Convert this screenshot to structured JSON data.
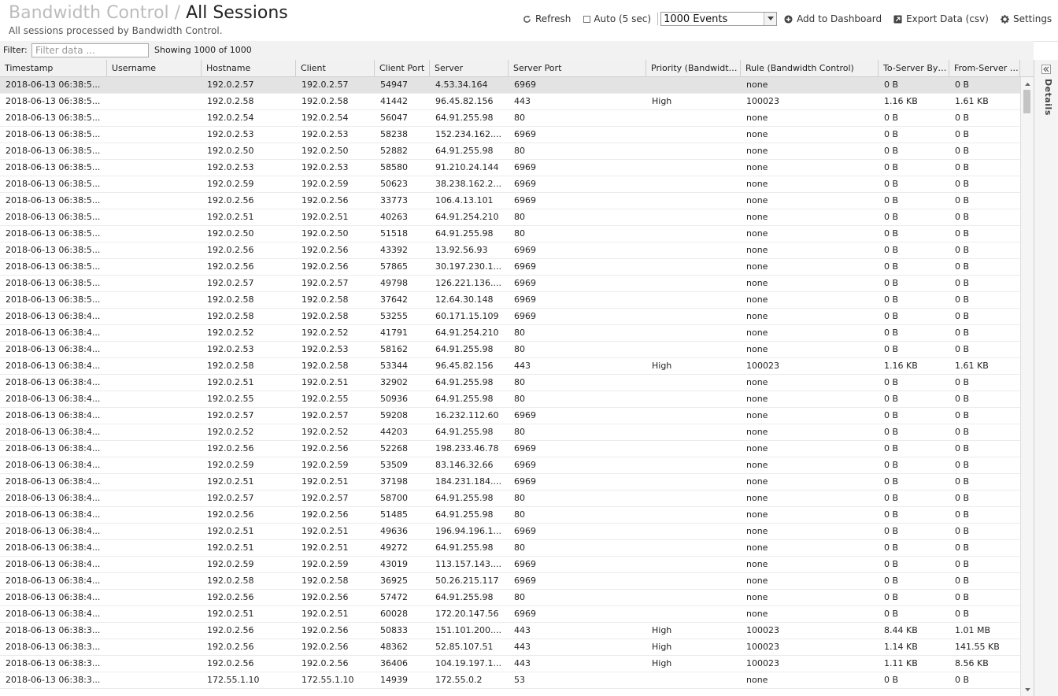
{
  "header": {
    "crumb": "Bandwidth Control",
    "separator": "/",
    "title": "All Sessions",
    "subtitle": "All sessions processed by Bandwidth Control."
  },
  "toolbar": {
    "refresh": "Refresh",
    "auto": "Auto (5 sec)",
    "events_selected": "1000 Events",
    "add_dashboard": "Add to Dashboard",
    "export": "Export Data (csv)",
    "settings": "Settings"
  },
  "filter": {
    "label": "Filter:",
    "placeholder": "Filter data ...",
    "showing": "Showing 1000 of 1000"
  },
  "columns": [
    "Timestamp",
    "Username",
    "Hostname",
    "Client",
    "Client Port",
    "Server",
    "Server Port",
    "Priority (Bandwidth Control)",
    "Rule (Bandwidth Control)",
    "To-Server Bytes",
    "From-Server Bytes"
  ],
  "rows": [
    [
      "2018-06-13 06:38:5...",
      "",
      "192.0.2.57",
      "192.0.2.57",
      "54947",
      "4.53.34.164",
      "6969",
      "",
      "none",
      "0 B",
      "0 B"
    ],
    [
      "2018-06-13 06:38:5...",
      "",
      "192.0.2.58",
      "192.0.2.58",
      "41442",
      "96.45.82.156",
      "443",
      "High",
      "100023",
      "1.16 KB",
      "1.61 KB"
    ],
    [
      "2018-06-13 06:38:5...",
      "",
      "192.0.2.54",
      "192.0.2.54",
      "56047",
      "64.91.255.98",
      "80",
      "",
      "none",
      "0 B",
      "0 B"
    ],
    [
      "2018-06-13 06:38:5...",
      "",
      "192.0.2.53",
      "192.0.2.53",
      "58238",
      "152.234.162....",
      "6969",
      "",
      "none",
      "0 B",
      "0 B"
    ],
    [
      "2018-06-13 06:38:5...",
      "",
      "192.0.2.50",
      "192.0.2.50",
      "52882",
      "64.91.255.98",
      "80",
      "",
      "none",
      "0 B",
      "0 B"
    ],
    [
      "2018-06-13 06:38:5...",
      "",
      "192.0.2.53",
      "192.0.2.53",
      "58580",
      "91.210.24.144",
      "6969",
      "",
      "none",
      "0 B",
      "0 B"
    ],
    [
      "2018-06-13 06:38:5...",
      "",
      "192.0.2.59",
      "192.0.2.59",
      "50623",
      "38.238.162.2...",
      "6969",
      "",
      "none",
      "0 B",
      "0 B"
    ],
    [
      "2018-06-13 06:38:5...",
      "",
      "192.0.2.56",
      "192.0.2.56",
      "33773",
      "106.4.13.101",
      "6969",
      "",
      "none",
      "0 B",
      "0 B"
    ],
    [
      "2018-06-13 06:38:5...",
      "",
      "192.0.2.51",
      "192.0.2.51",
      "40263",
      "64.91.254.210",
      "80",
      "",
      "none",
      "0 B",
      "0 B"
    ],
    [
      "2018-06-13 06:38:5...",
      "",
      "192.0.2.50",
      "192.0.2.50",
      "51518",
      "64.91.255.98",
      "80",
      "",
      "none",
      "0 B",
      "0 B"
    ],
    [
      "2018-06-13 06:38:5...",
      "",
      "192.0.2.56",
      "192.0.2.56",
      "43392",
      "13.92.56.93",
      "6969",
      "",
      "none",
      "0 B",
      "0 B"
    ],
    [
      "2018-06-13 06:38:5...",
      "",
      "192.0.2.56",
      "192.0.2.56",
      "57865",
      "30.197.230.1...",
      "6969",
      "",
      "none",
      "0 B",
      "0 B"
    ],
    [
      "2018-06-13 06:38:5...",
      "",
      "192.0.2.57",
      "192.0.2.57",
      "49798",
      "126.221.136....",
      "6969",
      "",
      "none",
      "0 B",
      "0 B"
    ],
    [
      "2018-06-13 06:38:5...",
      "",
      "192.0.2.58",
      "192.0.2.58",
      "37642",
      "12.64.30.148",
      "6969",
      "",
      "none",
      "0 B",
      "0 B"
    ],
    [
      "2018-06-13 06:38:4...",
      "",
      "192.0.2.58",
      "192.0.2.58",
      "53255",
      "60.171.15.109",
      "6969",
      "",
      "none",
      "0 B",
      "0 B"
    ],
    [
      "2018-06-13 06:38:4...",
      "",
      "192.0.2.52",
      "192.0.2.52",
      "41791",
      "64.91.254.210",
      "80",
      "",
      "none",
      "0 B",
      "0 B"
    ],
    [
      "2018-06-13 06:38:4...",
      "",
      "192.0.2.53",
      "192.0.2.53",
      "58162",
      "64.91.255.98",
      "80",
      "",
      "none",
      "0 B",
      "0 B"
    ],
    [
      "2018-06-13 06:38:4...",
      "",
      "192.0.2.58",
      "192.0.2.58",
      "53344",
      "96.45.82.156",
      "443",
      "High",
      "100023",
      "1.16 KB",
      "1.61 KB"
    ],
    [
      "2018-06-13 06:38:4...",
      "",
      "192.0.2.51",
      "192.0.2.51",
      "32902",
      "64.91.255.98",
      "80",
      "",
      "none",
      "0 B",
      "0 B"
    ],
    [
      "2018-06-13 06:38:4...",
      "",
      "192.0.2.55",
      "192.0.2.55",
      "50936",
      "64.91.255.98",
      "80",
      "",
      "none",
      "0 B",
      "0 B"
    ],
    [
      "2018-06-13 06:38:4...",
      "",
      "192.0.2.57",
      "192.0.2.57",
      "59208",
      "16.232.112.60",
      "6969",
      "",
      "none",
      "0 B",
      "0 B"
    ],
    [
      "2018-06-13 06:38:4...",
      "",
      "192.0.2.52",
      "192.0.2.52",
      "44203",
      "64.91.255.98",
      "80",
      "",
      "none",
      "0 B",
      "0 B"
    ],
    [
      "2018-06-13 06:38:4...",
      "",
      "192.0.2.56",
      "192.0.2.56",
      "52268",
      "198.233.46.78",
      "6969",
      "",
      "none",
      "0 B",
      "0 B"
    ],
    [
      "2018-06-13 06:38:4...",
      "",
      "192.0.2.59",
      "192.0.2.59",
      "53509",
      "83.146.32.66",
      "6969",
      "",
      "none",
      "0 B",
      "0 B"
    ],
    [
      "2018-06-13 06:38:4...",
      "",
      "192.0.2.51",
      "192.0.2.51",
      "37198",
      "184.231.184....",
      "6969",
      "",
      "none",
      "0 B",
      "0 B"
    ],
    [
      "2018-06-13 06:38:4...",
      "",
      "192.0.2.57",
      "192.0.2.57",
      "58700",
      "64.91.255.98",
      "80",
      "",
      "none",
      "0 B",
      "0 B"
    ],
    [
      "2018-06-13 06:38:4...",
      "",
      "192.0.2.56",
      "192.0.2.56",
      "51485",
      "64.91.255.98",
      "80",
      "",
      "none",
      "0 B",
      "0 B"
    ],
    [
      "2018-06-13 06:38:4...",
      "",
      "192.0.2.51",
      "192.0.2.51",
      "49636",
      "196.94.196.1...",
      "6969",
      "",
      "none",
      "0 B",
      "0 B"
    ],
    [
      "2018-06-13 06:38:4...",
      "",
      "192.0.2.51",
      "192.0.2.51",
      "49272",
      "64.91.255.98",
      "80",
      "",
      "none",
      "0 B",
      "0 B"
    ],
    [
      "2018-06-13 06:38:4...",
      "",
      "192.0.2.59",
      "192.0.2.59",
      "43019",
      "113.157.143....",
      "6969",
      "",
      "none",
      "0 B",
      "0 B"
    ],
    [
      "2018-06-13 06:38:4...",
      "",
      "192.0.2.58",
      "192.0.2.58",
      "36925",
      "50.26.215.117",
      "6969",
      "",
      "none",
      "0 B",
      "0 B"
    ],
    [
      "2018-06-13 06:38:4...",
      "",
      "192.0.2.56",
      "192.0.2.56",
      "57472",
      "64.91.255.98",
      "80",
      "",
      "none",
      "0 B",
      "0 B"
    ],
    [
      "2018-06-13 06:38:4...",
      "",
      "192.0.2.51",
      "192.0.2.51",
      "60028",
      "172.20.147.56",
      "6969",
      "",
      "none",
      "0 B",
      "0 B"
    ],
    [
      "2018-06-13 06:38:3...",
      "",
      "192.0.2.56",
      "192.0.2.56",
      "50833",
      "151.101.200....",
      "443",
      "High",
      "100023",
      "8.44 KB",
      "1.01 MB"
    ],
    [
      "2018-06-13 06:38:3...",
      "",
      "192.0.2.56",
      "192.0.2.56",
      "48362",
      "52.85.107.51",
      "443",
      "High",
      "100023",
      "1.14 KB",
      "141.55 KB"
    ],
    [
      "2018-06-13 06:38:3...",
      "",
      "192.0.2.56",
      "192.0.2.56",
      "36406",
      "104.19.197.1...",
      "443",
      "High",
      "100023",
      "1.11 KB",
      "8.56 KB"
    ],
    [
      "2018-06-13 06:38:3...",
      "",
      "172.55.1.10",
      "172.55.1.10",
      "14939",
      "172.55.0.2",
      "53",
      "",
      "none",
      "0 B",
      "0 B"
    ]
  ],
  "side": {
    "label": "Details"
  },
  "colors": {
    "selected_row": "#e3e3e3",
    "header_bg": "#f1f1f1",
    "crumb": "#bcbcbc"
  }
}
